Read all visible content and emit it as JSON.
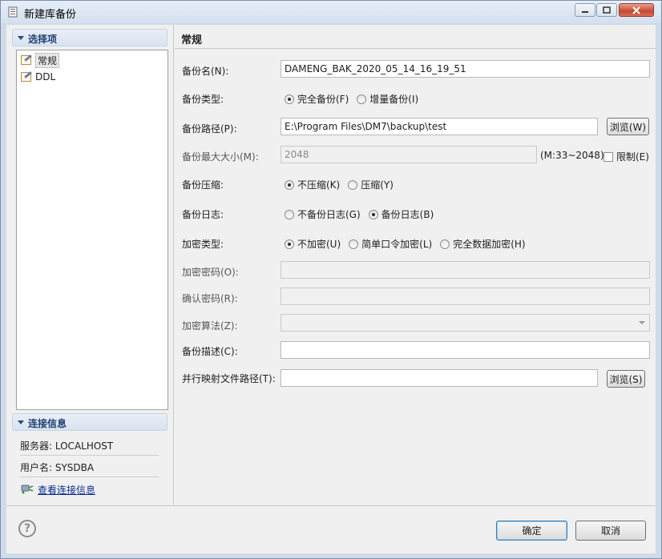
{
  "window": {
    "title": "新建库备份",
    "icon": "backup-db-icon"
  },
  "left": {
    "options_header": "选择项",
    "tree": [
      {
        "label": "常规",
        "selected": true
      },
      {
        "label": "DDL",
        "selected": false
      }
    ],
    "conn_header": "连接信息",
    "server_line": "服务器: LOCALHOST",
    "user_line": "用户名: SYSDBA",
    "view_conn_link": "查看连接信息"
  },
  "right": {
    "section_title": "常规",
    "fields": {
      "backup_name_label": "备份名(N):",
      "backup_name_value": "DAMENG_BAK_2020_05_14_16_19_51",
      "backup_type_label": "备份类型:",
      "backup_type_full": "完全备份(F)",
      "backup_type_incr": "增量备份(I)",
      "backup_path_label": "备份路径(P):",
      "backup_path_value": "E:\\Program Files\\DM7\\backup\\test",
      "browse_w": "浏览(W)",
      "max_size_label": "备份最大大小(M):",
      "max_size_value": "2048",
      "max_size_hint": "(M:33~2048)",
      "limit_check": "限制(E)",
      "compress_label": "备份压缩:",
      "compress_no": "不压缩(K)",
      "compress_yes": "压缩(Y)",
      "log_label": "备份日志:",
      "log_no": "不备份日志(G)",
      "log_yes": "备份日志(B)",
      "encrypt_type_label": "加密类型:",
      "encrypt_none": "不加密(U)",
      "encrypt_simple": "简单口令加密(L)",
      "encrypt_full": "完全数据加密(H)",
      "encrypt_pwd_label": "加密密码(O):",
      "confirm_pwd_label": "确认密码(R):",
      "encrypt_algo_label": "加密算法(Z):",
      "desc_label": "备份描述(C):",
      "parallel_label": "并行映射文件路径(T):",
      "browse_s": "浏览(S)"
    }
  },
  "footer": {
    "help": "?",
    "ok": "确定",
    "cancel": "取消"
  }
}
